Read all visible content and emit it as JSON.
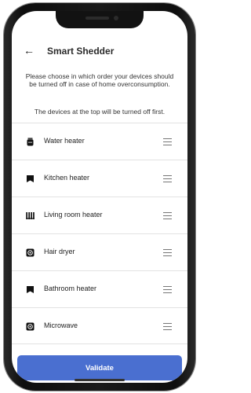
{
  "header": {
    "back_icon": "back-arrow-icon",
    "back_glyph": "←",
    "title": "Smart Shedder"
  },
  "instructions": {
    "text": "Please choose in which order your devices should be turned off in case of home overconsumption.",
    "subtext": "The devices at the top will be turned off first."
  },
  "devices": [
    {
      "label": "Water heater",
      "icon": "water-heater-icon"
    },
    {
      "label": "Kitchen heater",
      "icon": "heater-icon"
    },
    {
      "label": "Living room heater",
      "icon": "radiator-icon"
    },
    {
      "label": "Hair dryer",
      "icon": "appliance-icon"
    },
    {
      "label": "Bathroom heater",
      "icon": "heater-icon"
    },
    {
      "label": "Microwave",
      "icon": "appliance-icon"
    }
  ],
  "actions": {
    "validate_label": "Validate"
  },
  "colors": {
    "accent": "#4a6fd0",
    "text": "#222222",
    "divider": "#e2e2e2"
  }
}
